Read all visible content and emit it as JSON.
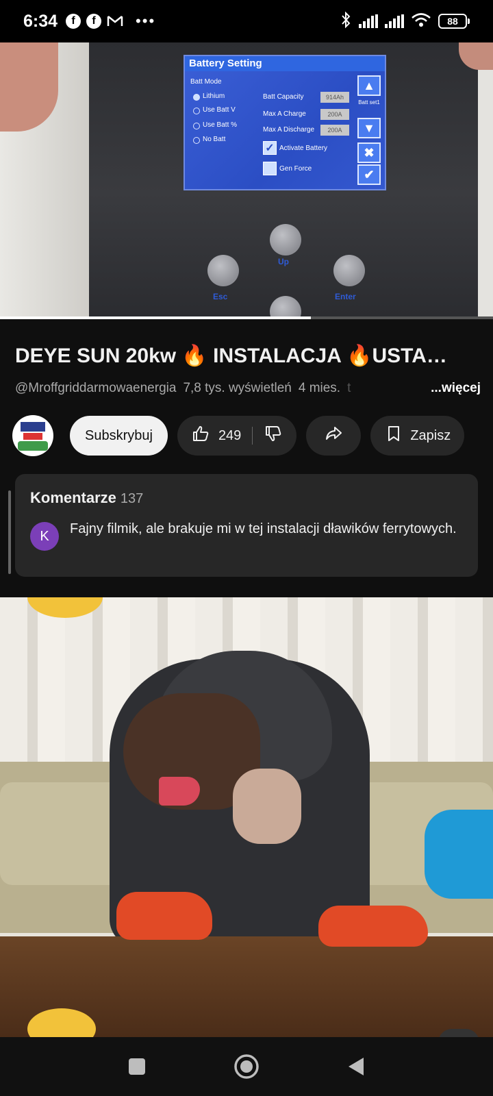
{
  "status_bar": {
    "time": "6:34",
    "notification_icons": [
      "facebook-icon",
      "facebook-icon",
      "gmail-icon"
    ],
    "more_indicator": "•••",
    "battery_level": "88"
  },
  "video": {
    "progress_fraction": 0.63,
    "screen": {
      "title": "Battery Setting",
      "batt_mode_label": "Batt Mode",
      "modes": [
        "Lithium",
        "Use Batt V",
        "Use Batt %",
        "No Batt"
      ],
      "fields": [
        {
          "label": "Batt Capacity",
          "value": "914Ah"
        },
        {
          "label": "Max A Charge",
          "value": "200A"
        },
        {
          "label": "Max A Discharge",
          "value": "200A"
        }
      ],
      "activate_battery": "Activate Battery",
      "gen_force": "Gen Force",
      "side_label": "Batt set1"
    },
    "buttons": {
      "up": "Up",
      "esc": "Esc",
      "enter": "Enter"
    }
  },
  "details": {
    "title": "DEYE SUN 20kw 🔥 INSTALACJA 🔥USTA…",
    "channel": "@Mroffgriddarmowaenergia",
    "views": "7,8 tys. wyświetleń",
    "age": "4 mies.",
    "faded": "t",
    "more": "...więcej"
  },
  "actions": {
    "subscribe": "Subskrybuj",
    "likes": "249",
    "save": "Zapisz"
  },
  "comments": {
    "heading": "Komentarze",
    "count": "137",
    "top_comment": {
      "avatar_letter": "K",
      "text": "Fajny filmik, ale brakuje mi w tej instalacji dławików ferrytowych."
    }
  },
  "colors": {
    "background": "#0f0f0f",
    "pill": "#272727",
    "subscribe_bg": "#f1f1f1",
    "comment_avatar": "#7b3fb8"
  }
}
